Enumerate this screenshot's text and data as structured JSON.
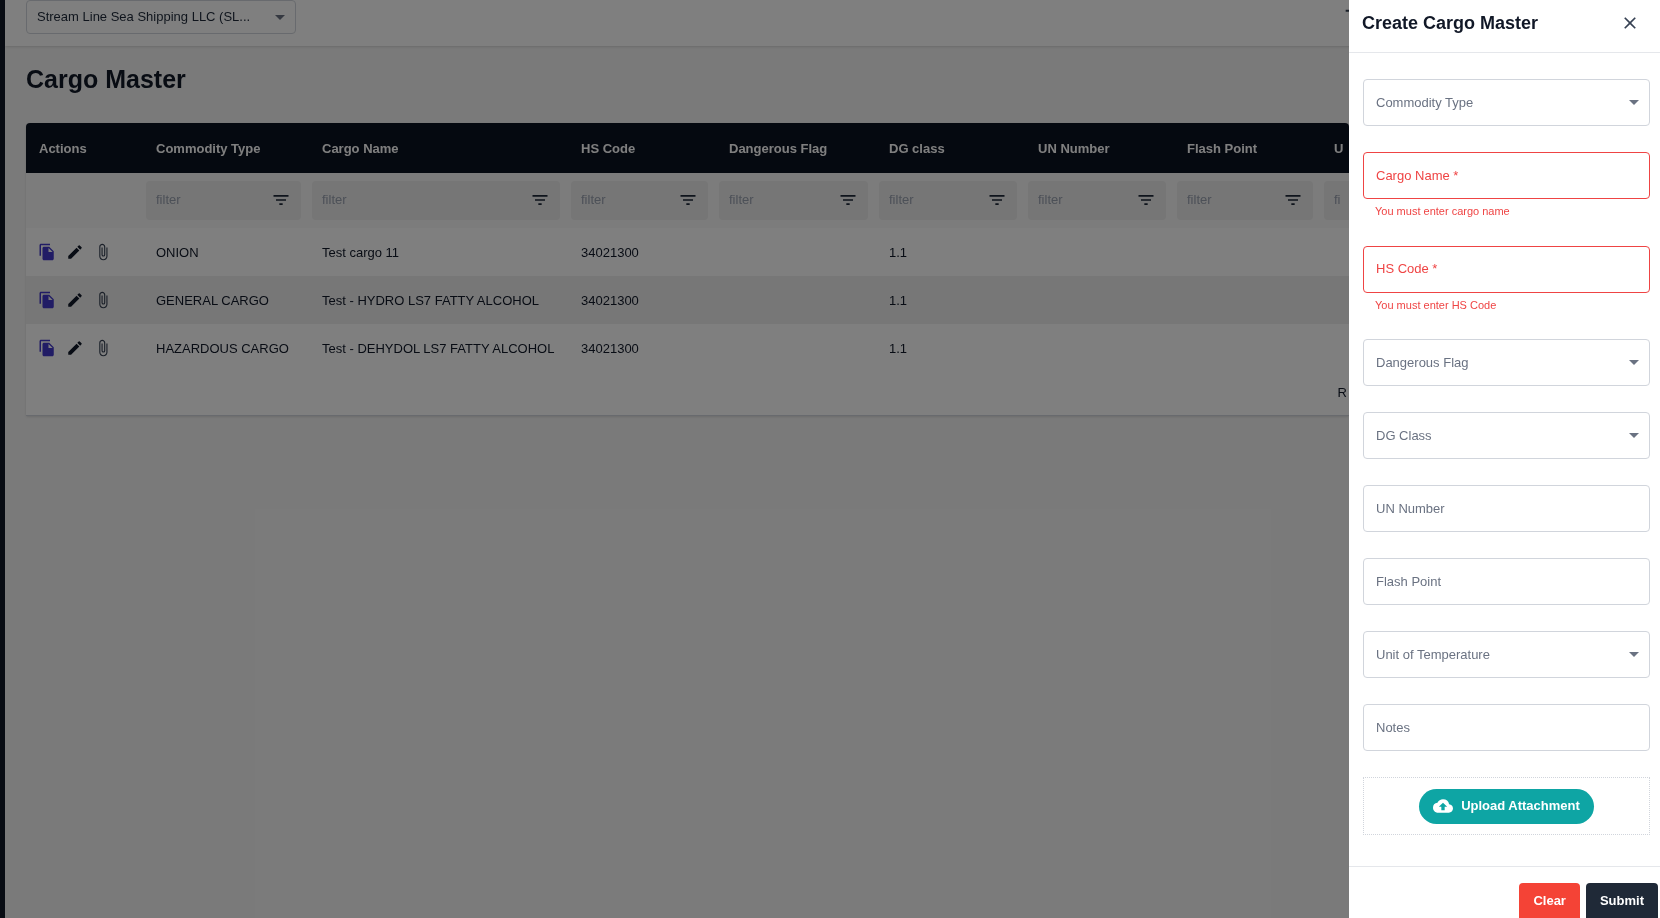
{
  "company_selector": {
    "value": "Stream Line Sea Shipping LLC  (SL..."
  },
  "page_title": "Cargo Master",
  "table": {
    "columns": [
      {
        "label": "Actions"
      },
      {
        "label": "Commodity Type",
        "filter_placeholder": "filter"
      },
      {
        "label": "Cargo Name",
        "filter_placeholder": "filter"
      },
      {
        "label": "HS Code",
        "filter_placeholder": "filter"
      },
      {
        "label": "Dangerous Flag",
        "filter_placeholder": "filter"
      },
      {
        "label": "DG class",
        "filter_placeholder": "filter"
      },
      {
        "label": "UN Number",
        "filter_placeholder": "filter"
      },
      {
        "label": "Flash Point",
        "filter_placeholder": "filter"
      },
      {
        "label": "U",
        "filter_placeholder": "fi"
      }
    ],
    "rows": [
      {
        "commodity_type": "ONION",
        "cargo_name": "Test cargo 11",
        "hs_code": "34021300",
        "dg_class": "1.1"
      },
      {
        "commodity_type": "GENERAL CARGO",
        "cargo_name": "Test - HYDRO LS7 FATTY ALCOHOL",
        "hs_code": "34021300",
        "dg_class": "1.1"
      },
      {
        "commodity_type": "HAZARDOUS CARGO",
        "cargo_name": "Test - DEHYDOL LS7 FATTY ALCOHOL",
        "hs_code": "34021300",
        "dg_class": "1.1"
      }
    ],
    "footer_text": "R"
  },
  "drawer": {
    "title": "Create Cargo Master",
    "fields": [
      {
        "kind": "select",
        "placeholder": "Commodity Type",
        "invalid": false
      },
      {
        "kind": "text",
        "placeholder": "Cargo Name *",
        "invalid": true,
        "error": "You must enter cargo name"
      },
      {
        "kind": "text",
        "placeholder": "HS Code *",
        "invalid": true,
        "error": "You must enter HS Code"
      },
      {
        "kind": "select",
        "placeholder": "Dangerous Flag",
        "invalid": false
      },
      {
        "kind": "select",
        "placeholder": "DG Class",
        "invalid": false
      },
      {
        "kind": "text",
        "placeholder": "UN Number",
        "invalid": false
      },
      {
        "kind": "text",
        "placeholder": "Flash Point",
        "invalid": false
      },
      {
        "kind": "select",
        "placeholder": "Unit of Temperature",
        "invalid": false
      },
      {
        "kind": "text",
        "placeholder": "Notes",
        "invalid": false
      }
    ],
    "upload_button": "Upload Attachment",
    "buttons": [
      {
        "kind": "clear",
        "label": "Clear"
      },
      {
        "kind": "submit",
        "label": "Submit"
      }
    ]
  }
}
